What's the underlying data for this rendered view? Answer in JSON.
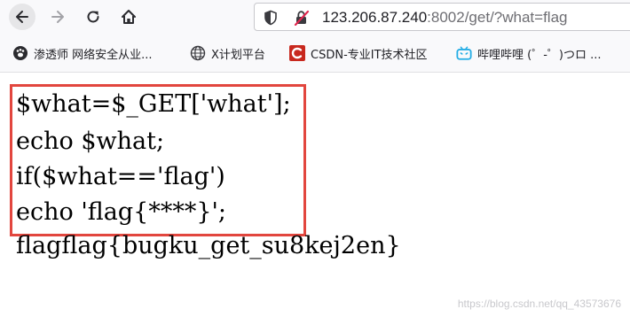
{
  "browser": {
    "url_host": "123.206.87.240",
    "url_rest": ":8002/get/?what=flag"
  },
  "bookmarks": [
    {
      "label": "渗透师 网络安全从业...",
      "icon": "paw-icon"
    },
    {
      "label": "X计划平台",
      "icon": "globe-icon"
    },
    {
      "label": "CSDN-专业IT技术社区",
      "icon": "csdn-icon"
    },
    {
      "label": "哔哩哔哩 (゜-゜)つロ ...",
      "icon": "bilibili-icon"
    }
  ],
  "page": {
    "code_lines": [
      "$what=$_GET['what'];",
      "echo $what;",
      "if($what=='flag')",
      "echo 'flag{****}';"
    ],
    "output_line": "flagflag{bugku_get_su8kej2en}",
    "watermark": "https://blog.csdn.net/qq_43573676"
  },
  "colors": {
    "highlight_border": "#e2463e",
    "csdn_red": "#c8281e",
    "bilibili_blue": "#23ade5"
  }
}
